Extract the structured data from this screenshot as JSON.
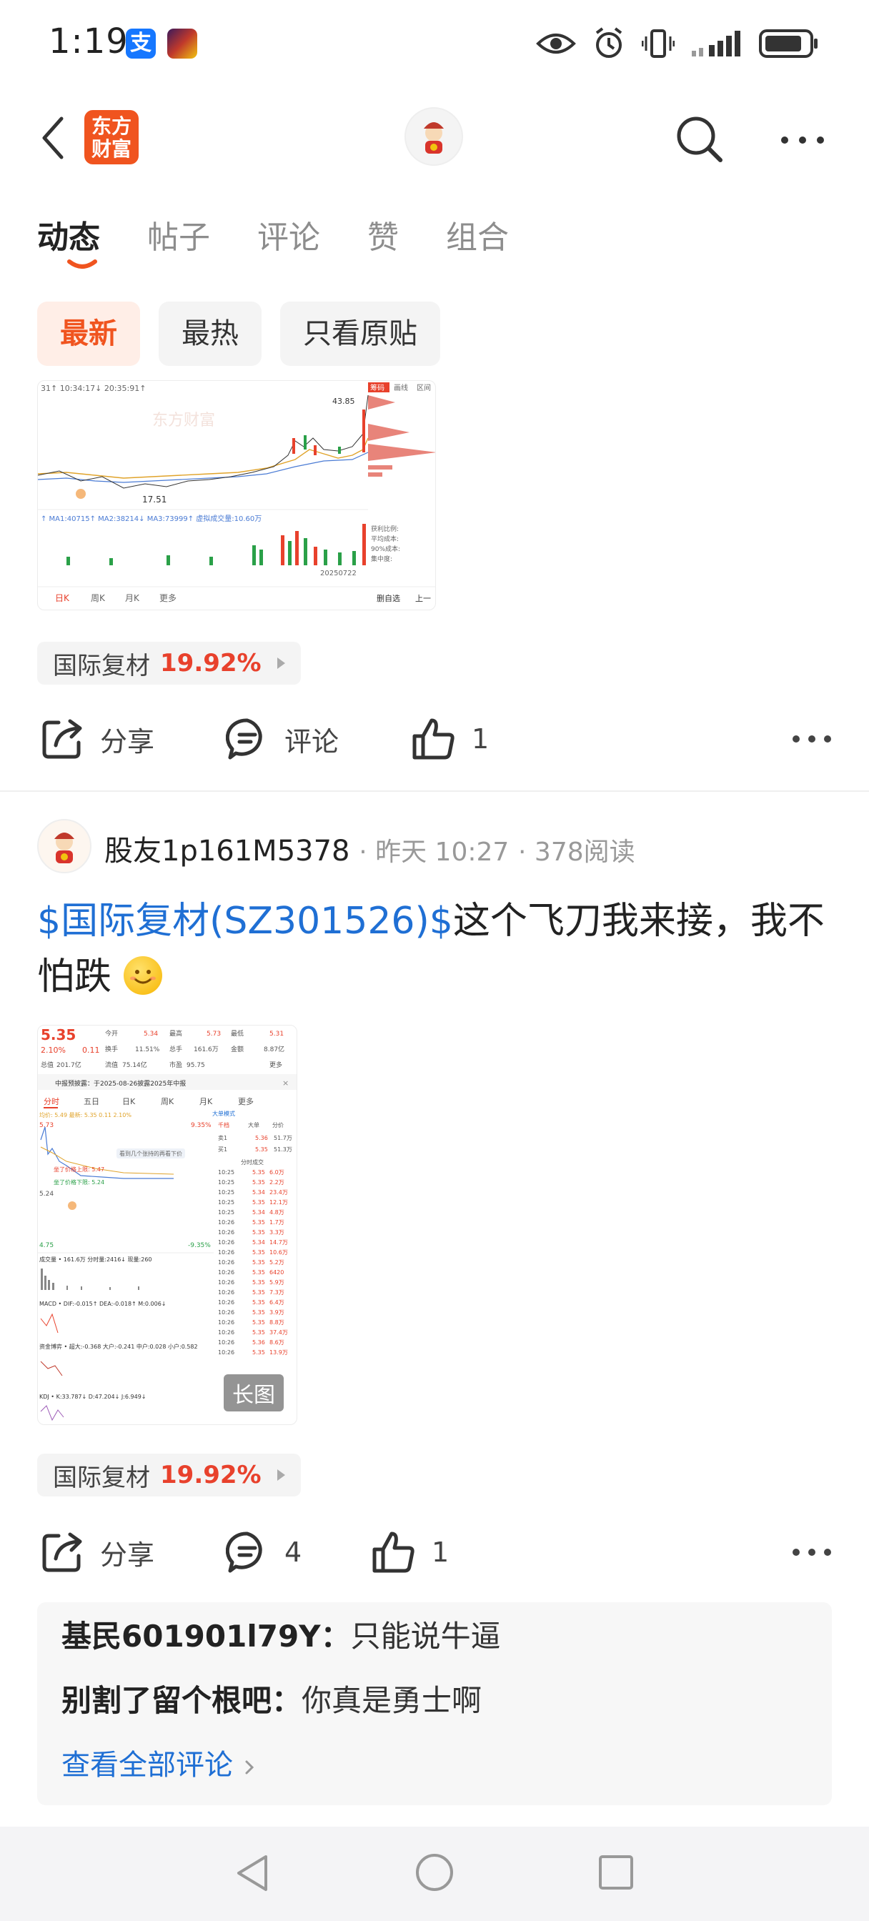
{
  "status_bar": {
    "time": "1:19",
    "app1_glyph": "支",
    "icons": [
      "eye-icon",
      "alarm-icon",
      "vibrate-icon",
      "signal-icon",
      "battery-icon"
    ]
  },
  "header": {
    "brand_logo": "东方\n财富",
    "icons": [
      "back-icon",
      "search-icon",
      "more-icon"
    ]
  },
  "tabs": [
    {
      "label": "动态",
      "active": true
    },
    {
      "label": "帖子",
      "active": false
    },
    {
      "label": "评论",
      "active": false
    },
    {
      "label": "赞",
      "active": false
    },
    {
      "label": "组合",
      "active": false
    }
  ],
  "filters": [
    {
      "label": "最新",
      "active": true
    },
    {
      "label": "最热",
      "active": false
    },
    {
      "label": "只看原贴",
      "active": false
    }
  ],
  "post1": {
    "stock_tag": {
      "name": "国际复材",
      "change": "19.92%"
    },
    "actions": {
      "share": "分享",
      "comment": "评论",
      "like_count": "1"
    },
    "chart": {
      "top_left": "31↑ 10:34:17↓ 20:35:91↑",
      "tabs": [
        "筹码",
        "画线",
        "区间"
      ],
      "high_label": "43.85",
      "low_label": "17.51",
      "ma_line": "↑ MA1:40715↑  MA2:38214↓  MA3:73999↑  虚拟成交量:10.60万",
      "date": "20250722",
      "bottom_tabs": [
        "日K",
        "周K",
        "月K",
        "更多"
      ],
      "bottom_right": [
        "删自选",
        "上一"
      ],
      "side_labels": [
        "获利比例:",
        "平均成本:",
        "90%成本:",
        "集中度:"
      ],
      "watermark": "东方财富"
    }
  },
  "post2": {
    "author": "股友1p161M5378",
    "time": "昨天 10:27",
    "reads": "378阅读",
    "text_link": "$国际复材(SZ301526)$",
    "text_body": "这个飞刀我来接，我不怕跌",
    "stock_tag": {
      "name": "国际复材",
      "change": "19.92%"
    },
    "actions": {
      "share": "分享",
      "comment_count": "4",
      "like_count": "1"
    },
    "chart": {
      "price": "5.35",
      "change_pct": "2.10%",
      "change_abs": "0.11",
      "row1": [
        "今开",
        "5.34",
        "最高",
        "5.73",
        "最低",
        "5.31"
      ],
      "row2": [
        "换手",
        "11.51%",
        "总手",
        "161.6万",
        "金额",
        "8.87亿"
      ],
      "row3": [
        "总值",
        "201.7亿",
        "流值",
        "75.14亿",
        "市盈",
        "95.75",
        "更多"
      ],
      "notice": "中报预披露：于2025-08-26披露2025年中报",
      "tabs": [
        "分时",
        "五日",
        "日K",
        "周K",
        "月K",
        "更多"
      ],
      "avg_line": "均价: 5.49  最新: 5.35  0.11  2.10%",
      "top_pct": "9.35%",
      "bot_pct": "-9.35%",
      "price_top": "5.73",
      "price_mid": "5.24",
      "price_bot": "4.75",
      "mode": "大单模式",
      "book_tabs": [
        "千档",
        "大单",
        "分价"
      ],
      "sell1": [
        "卖1",
        "5.36",
        "51.7万"
      ],
      "buy1": [
        "买1",
        "5.35",
        "51.3万"
      ],
      "ticks_title": "分时成交",
      "ticks": [
        [
          "10:25",
          "5.35",
          "6.0万"
        ],
        [
          "10:25",
          "5.35",
          "2.2万"
        ],
        [
          "10:25",
          "5.34",
          "23.4万"
        ],
        [
          "10:25",
          "5.35",
          "12.1万"
        ],
        [
          "10:25",
          "5.34",
          "4.8万"
        ],
        [
          "10:26",
          "5.35",
          "1.7万"
        ],
        [
          "10:26",
          "5.35",
          "3.3万"
        ],
        [
          "10:26",
          "5.34",
          "14.7万"
        ],
        [
          "10:26",
          "5.35",
          "10.6万"
        ],
        [
          "10:26",
          "5.35",
          "5.2万"
        ],
        [
          "10:26",
          "5.35",
          "6420"
        ],
        [
          "10:26",
          "5.35",
          "5.9万"
        ],
        [
          "10:26",
          "5.35",
          "7.3万"
        ],
        [
          "10:26",
          "5.35",
          "6.4万"
        ],
        [
          "10:26",
          "5.35",
          "3.9万"
        ],
        [
          "10:26",
          "5.35",
          "8.8万"
        ],
        [
          "10:26",
          "5.35",
          "37.4万"
        ],
        [
          "10:26",
          "5.36",
          "8.6万"
        ],
        [
          "10:26",
          "5.35",
          "13.9万"
        ]
      ],
      "limit_up_label": "坐了价格上限: 5.47",
      "limit_dn_label": "坐了价格下限: 5.24",
      "hint": "看到几个张持的再看下价",
      "vol_line": "成交量 • 161.6万   分时量:2416↓   现量:260",
      "macd_line": "MACD • DIF:-0.015↑  DEA:-0.018↑  M:0.006↓",
      "fund_line": "资金博弈 • 超大:-0.368  大户:-0.241  中户:0.028  小户:0.582",
      "kdj_line": "KDJ • K:33.787↓  D:47.204↓  J:6.949↓",
      "long_image": "长图"
    },
    "comments": [
      {
        "who": "基民601901l79Y",
        "what": "只能说牛逼"
      },
      {
        "who": "别割了留个根吧",
        "what": "你真是勇士啊"
      }
    ],
    "view_all": "查看全部评论"
  },
  "colors": {
    "brand": "#f0541f",
    "up_red": "#e8412c",
    "link_blue": "#1f6fd4"
  }
}
